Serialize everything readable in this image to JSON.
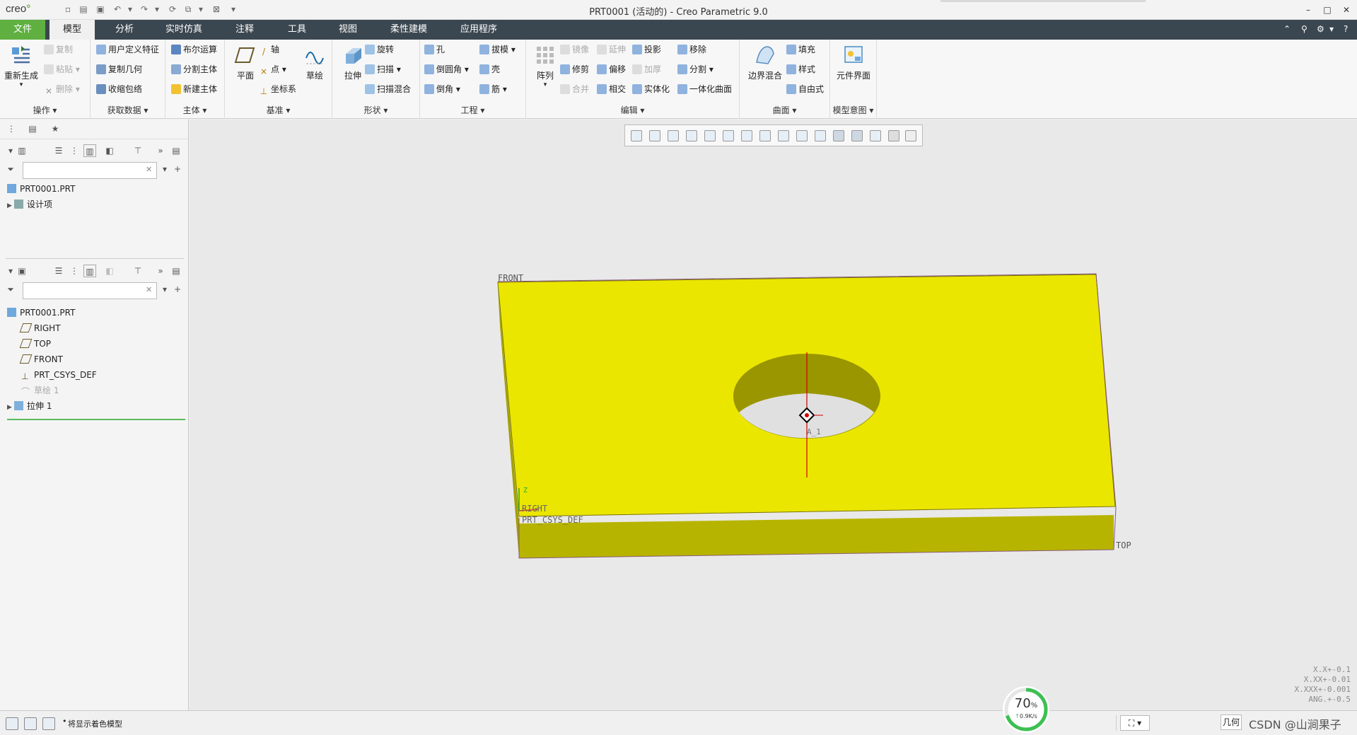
{
  "window": {
    "title": "PRT0001 (活动的) - Creo Parametric 9.0",
    "logo": "creo",
    "controls": [
      "–",
      "□",
      "✕"
    ]
  },
  "menu": {
    "tabs": [
      "文件",
      "模型",
      "分析",
      "实时仿真",
      "注释",
      "工具",
      "视图",
      "柔性建模",
      "应用程序"
    ],
    "active_tab": "模型",
    "right_icons": [
      "⌃",
      "⚲",
      "⚙",
      "▾",
      "?"
    ]
  },
  "ribbon": {
    "groups": [
      {
        "label": "操作 ▾",
        "big": "重新生成",
        "small": [
          {
            "t": "复制",
            "dis": true
          },
          {
            "t": "粘贴 ▾",
            "dis": true
          },
          {
            "t": "删除 ▾",
            "dis": true
          }
        ]
      },
      {
        "label": "获取数据 ▾",
        "small": [
          {
            "t": "用户定义特征",
            "dis": false
          },
          {
            "t": "复制几何",
            "dis": false
          },
          {
            "t": "收缩包络",
            "dis": false
          }
        ]
      },
      {
        "label": "主体 ▾",
        "small": [
          {
            "t": "布尔运算",
            "dis": false
          },
          {
            "t": "分割主体",
            "dis": false
          },
          {
            "t": "新建主体",
            "dis": false
          }
        ]
      },
      {
        "label": "基准 ▾",
        "big": "平面",
        "big2": "草绘",
        "small": [
          {
            "t": "轴",
            "dis": false
          },
          {
            "t": "点 ▾",
            "dis": false
          },
          {
            "t": "坐标系",
            "dis": false
          }
        ]
      },
      {
        "label": "形状 ▾",
        "big": "拉伸",
        "small": [
          {
            "t": "旋转",
            "dis": false
          },
          {
            "t": "扫描 ▾",
            "dis": false
          },
          {
            "t": "扫描混合",
            "dis": false
          }
        ]
      },
      {
        "label": "工程 ▾",
        "small": [
          {
            "t": "孔",
            "dis": false
          },
          {
            "t": "倒圆角 ▾",
            "dis": false
          },
          {
            "t": "倒角 ▾",
            "dis": false
          },
          {
            "t": "拔模 ▾",
            "dis": false
          },
          {
            "t": "壳",
            "dis": false
          },
          {
            "t": "筋 ▾",
            "dis": false
          }
        ]
      },
      {
        "label": "编辑 ▾",
        "big": "阵列",
        "small": [
          {
            "t": "镜像",
            "dis": true
          },
          {
            "t": "修剪",
            "dis": false
          },
          {
            "t": "合并",
            "dis": true
          },
          {
            "t": "延伸",
            "dis": true
          },
          {
            "t": "偏移",
            "dis": false
          },
          {
            "t": "相交",
            "dis": false
          },
          {
            "t": "投影",
            "dis": false
          },
          {
            "t": "加厚",
            "dis": true
          },
          {
            "t": "实体化",
            "dis": false
          },
          {
            "t": "移除",
            "dis": false
          },
          {
            "t": "分割 ▾",
            "dis": false
          },
          {
            "t": "一体化曲面",
            "dis": false
          }
        ]
      },
      {
        "label": "曲面 ▾",
        "big": "边界混合",
        "small": [
          {
            "t": "填充",
            "dis": false
          },
          {
            "t": "样式",
            "dis": false
          },
          {
            "t": "自由式",
            "dis": false
          }
        ]
      },
      {
        "label": "模型意图 ▾",
        "big": "元件界面"
      }
    ]
  },
  "left_panel": {
    "top_tree": {
      "items": [
        {
          "label": "PRT0001.PRT",
          "icon": "part-icon",
          "disabled": false
        },
        {
          "label": "设计项",
          "icon": "design-items-icon",
          "disabled": false,
          "expander": "▶"
        }
      ]
    },
    "model_tree": {
      "items": [
        {
          "label": "PRT0001.PRT",
          "icon": "part-icon",
          "disabled": false
        },
        {
          "label": "RIGHT",
          "icon": "datum-plane-icon",
          "disabled": false
        },
        {
          "label": "TOP",
          "icon": "datum-plane-icon",
          "disabled": false
        },
        {
          "label": "FRONT",
          "icon": "datum-plane-icon",
          "disabled": false
        },
        {
          "label": "PRT_CSYS_DEF",
          "icon": "csys-icon",
          "disabled": false
        },
        {
          "label": "草绘 1",
          "icon": "sketch-icon",
          "disabled": true
        },
        {
          "label": "拉伸 1",
          "icon": "extrude-icon",
          "disabled": false,
          "expander": "▶"
        }
      ]
    }
  },
  "viewport": {
    "labels": {
      "front": "FRONT",
      "top": "TOP",
      "right": "RIGHT",
      "csys": "PRT_CSYS_DEF",
      "axis": "A_1",
      "z": "Z"
    },
    "colors": {
      "top_face": "#ebe600",
      "side_face": "#b7b400",
      "hole_wall": "#9a9600",
      "hole_floor": "#e0e0e0",
      "axis": "#d00000"
    },
    "tolerances": [
      "X.X+-0.1",
      "X.XX+-0.01",
      "X.XXX+-0.001",
      "ANG.+-0.5"
    ]
  },
  "status": {
    "message": "将显示着色模型",
    "perf_value": "70",
    "perf_unit": "%",
    "perf_rate": "0.9K/s",
    "geometry_filter": "几何",
    "watermark": "CSDN @山涧果子"
  }
}
